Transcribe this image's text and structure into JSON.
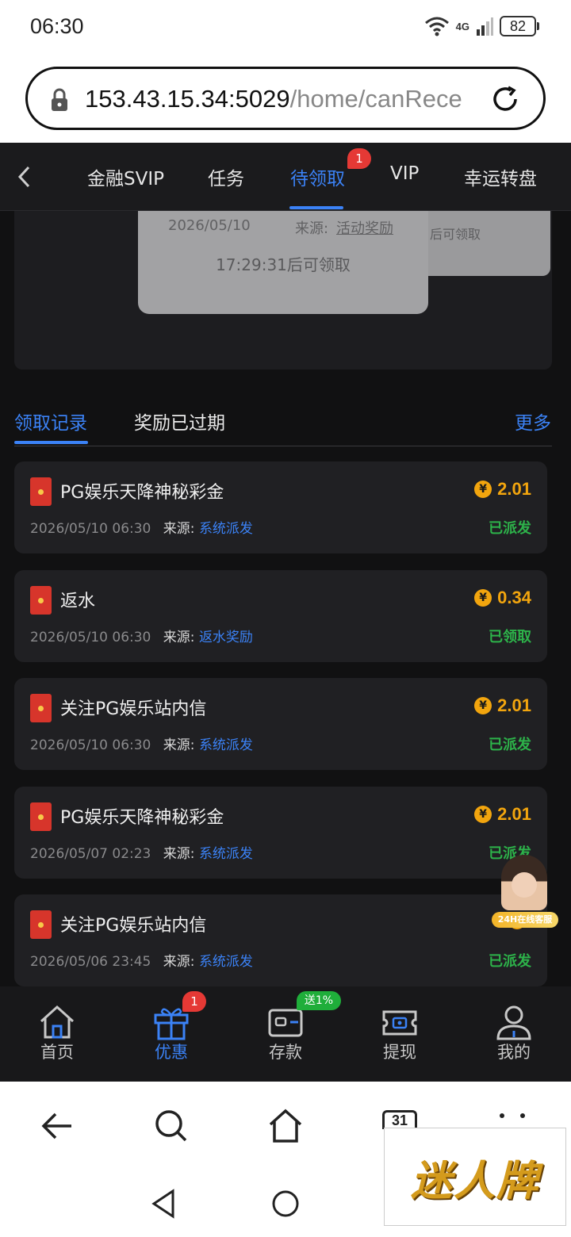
{
  "status_bar": {
    "time": "06:30",
    "network": "4G",
    "battery": "82"
  },
  "browser": {
    "url_host": "153.43.15.34:5029",
    "url_path": "/home/canRece"
  },
  "top_nav": {
    "tabs": [
      {
        "label": "金融SVIP"
      },
      {
        "label": "任务"
      },
      {
        "label": "待领取",
        "active": true,
        "badge": "1"
      },
      {
        "label": "VIP"
      },
      {
        "label": "幸运转盘"
      }
    ]
  },
  "pending_cards": {
    "back_card_text": "后可领取",
    "front_card": {
      "date": "2026/05/10",
      "source_label": "来源:",
      "source_value": "活动奖励",
      "countdown": "17:29:31后可领取"
    }
  },
  "record_tabs": {
    "tab1": "领取记录",
    "tab2": "奖励已过期",
    "more": "更多"
  },
  "records": [
    {
      "title": "PG娱乐天降神秘彩金",
      "amount": "2.01",
      "datetime": "2026/05/10 06:30",
      "source_label": "来源:",
      "source": "系统派发",
      "status": "已派发"
    },
    {
      "title": "返水",
      "amount": "0.34",
      "datetime": "2026/05/10 06:30",
      "source_label": "来源:",
      "source": "返水奖励",
      "status": "已领取"
    },
    {
      "title": "关注PG娱乐站内信",
      "amount": "2.01",
      "datetime": "2026/05/10 06:30",
      "source_label": "来源:",
      "source": "系统派发",
      "status": "已派发"
    },
    {
      "title": "PG娱乐天降神秘彩金",
      "amount": "2.01",
      "datetime": "2026/05/07 02:23",
      "source_label": "来源:",
      "source": "系统派发",
      "status": "已派发"
    },
    {
      "title": "关注PG娱乐站内信",
      "amount": "",
      "datetime": "2026/05/06 23:45",
      "source_label": "来源:",
      "source": "系统派发",
      "status": "已派发"
    }
  ],
  "customer_service": {
    "label": "24H在线客服"
  },
  "bottom_nav": {
    "items": [
      {
        "label": "首页",
        "icon": "home-icon"
      },
      {
        "label": "优惠",
        "icon": "gift-icon",
        "active": true,
        "badge": "1"
      },
      {
        "label": "存款",
        "icon": "wallet-icon",
        "promo": "送1%"
      },
      {
        "label": "提现",
        "icon": "withdraw-icon"
      },
      {
        "label": "我的",
        "icon": "profile-icon"
      }
    ]
  },
  "system_nav": {
    "calendar_day": "31"
  },
  "brand": {
    "text": "迷人牌"
  },
  "colors": {
    "accent": "#3b82f6",
    "amount": "#f2a50e",
    "status_green": "#2db34a",
    "badge_red": "#e53935",
    "app_bg": "#111112"
  }
}
